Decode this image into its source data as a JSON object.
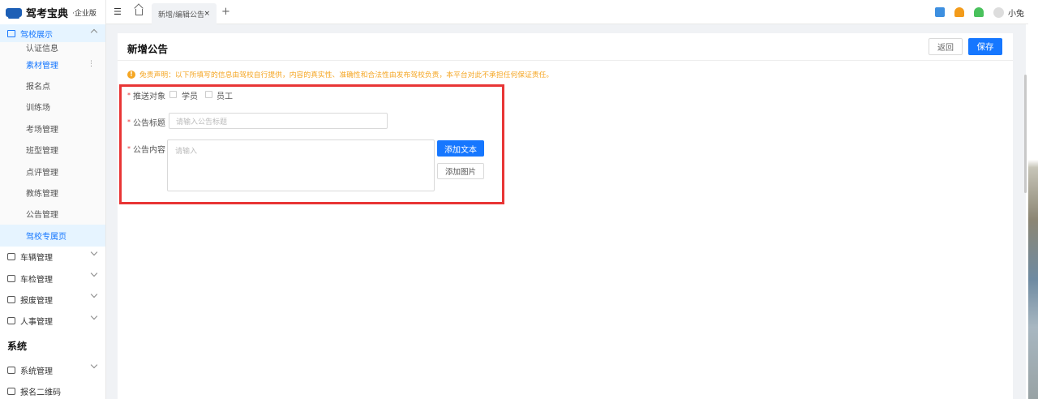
{
  "app": {
    "name": "驾考宝典",
    "edition": "·企业版"
  },
  "sidebar": {
    "expanded_group": "驾校展示",
    "sub_items": [
      {
        "label": "认证信息"
      },
      {
        "label": "素材管理"
      },
      {
        "label": "报名点"
      },
      {
        "label": "训练场"
      },
      {
        "label": "考场管理"
      },
      {
        "label": "班型管理"
      },
      {
        "label": "点评管理"
      },
      {
        "label": "教练管理"
      },
      {
        "label": "公告管理"
      },
      {
        "label": "驾校专属页"
      }
    ],
    "groups": [
      {
        "label": "车辆管理"
      },
      {
        "label": "车检管理"
      },
      {
        "label": "报废管理"
      },
      {
        "label": "人事管理"
      }
    ],
    "section_title": "系统",
    "system_items": [
      {
        "label": "系统管理"
      },
      {
        "label": "报名二维码"
      }
    ]
  },
  "topbar": {
    "tab_label": "新增/编辑公告",
    "tab_close": "×",
    "new_tab": "+",
    "user_name": "小兔"
  },
  "page": {
    "title": "新增公告",
    "back_label": "返回",
    "save_label": "保存",
    "notice": "免责声明：以下所填写的信息由驾校自行提供，内容的真实性、准确性和合法性由发布驾校负责，本平台对此不承担任何保证责任。"
  },
  "form": {
    "target_label": "推送对象",
    "target_options": [
      {
        "label": "学员",
        "checked": false
      },
      {
        "label": "员工",
        "checked": false
      }
    ],
    "title_label": "公告标题",
    "title_placeholder": "请输入公告标题",
    "content_label": "公告内容",
    "content_placeholder": "请输入",
    "add_text_label": "添加文本",
    "add_image_label": "添加图片",
    "required_mark": "*"
  },
  "colors": {
    "primary": "#1677ff",
    "warning": "#f5a623",
    "highlight": "#e83535"
  },
  "icons": [
    "menu-icon",
    "home-icon",
    "search-icon",
    "user-icon",
    "bell-icon",
    "avatar",
    "warning-icon"
  ]
}
